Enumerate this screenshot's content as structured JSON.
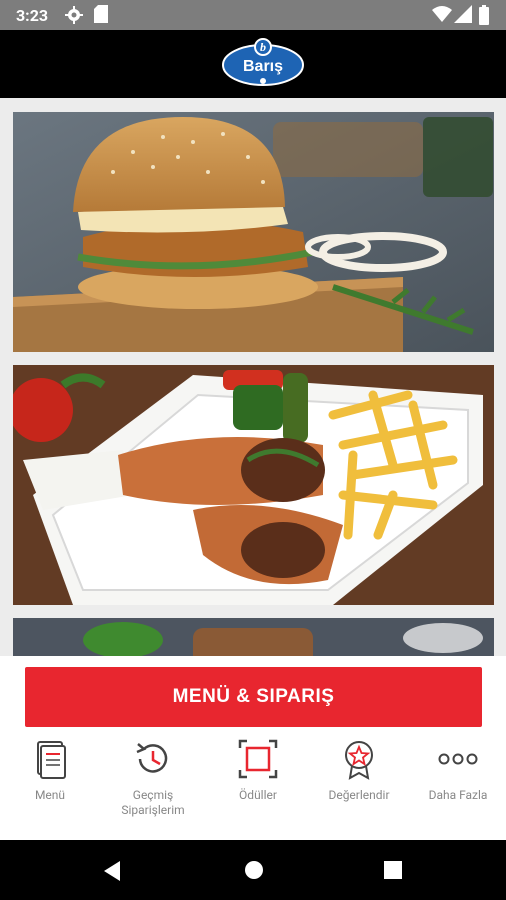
{
  "status_bar": {
    "time": "3:23"
  },
  "app": {
    "logo_text": "Barış"
  },
  "cta": {
    "label": "MENÜ & SIPARIŞ",
    "color": "#e8262f"
  },
  "nav": {
    "items": [
      {
        "label": "Menü",
        "icon": "menu-book-icon"
      },
      {
        "label": "Geçmiş Siparişlerim",
        "icon": "history-clock-icon"
      },
      {
        "label": "Ödüller",
        "icon": "rewards-frame-icon"
      },
      {
        "label": "Değerlendir",
        "icon": "rating-badge-icon"
      },
      {
        "label": "Daha Fazla",
        "icon": "more-dots-icon"
      }
    ]
  },
  "images": [
    {
      "name": "crispy-chicken-burger-photo"
    },
    {
      "name": "doner-wrap-with-fries-photo"
    },
    {
      "name": "partial-food-photo"
    }
  ]
}
